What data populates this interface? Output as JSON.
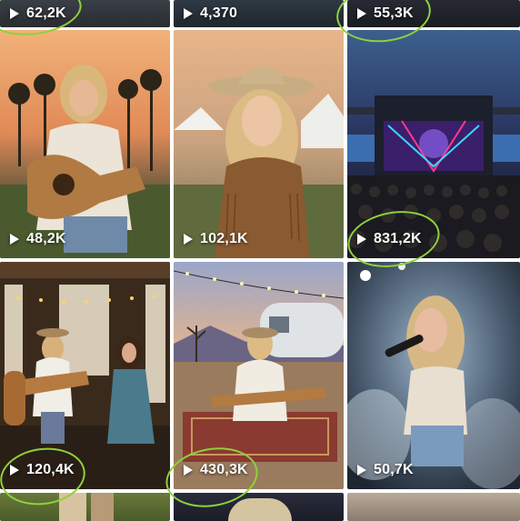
{
  "grid": {
    "tiles": [
      {
        "id": "t00",
        "views": "62,2K",
        "circled": true
      },
      {
        "id": "t01",
        "views": "4,370",
        "circled": false
      },
      {
        "id": "t02",
        "views": "55,3K",
        "circled": true
      },
      {
        "id": "t10",
        "views": "48,2K",
        "circled": false
      },
      {
        "id": "t11",
        "views": "102,1K",
        "circled": false
      },
      {
        "id": "t12",
        "views": "831,2K",
        "circled": true
      },
      {
        "id": "t20",
        "views": "120,4K",
        "circled": true
      },
      {
        "id": "t21",
        "views": "430,3K",
        "circled": true
      },
      {
        "id": "t22",
        "views": "50,7K",
        "circled": false
      }
    ]
  },
  "colors": {
    "highlight_circle": "#8fd13b",
    "background": "#ffffff"
  },
  "icons": {
    "play": "play-icon"
  }
}
